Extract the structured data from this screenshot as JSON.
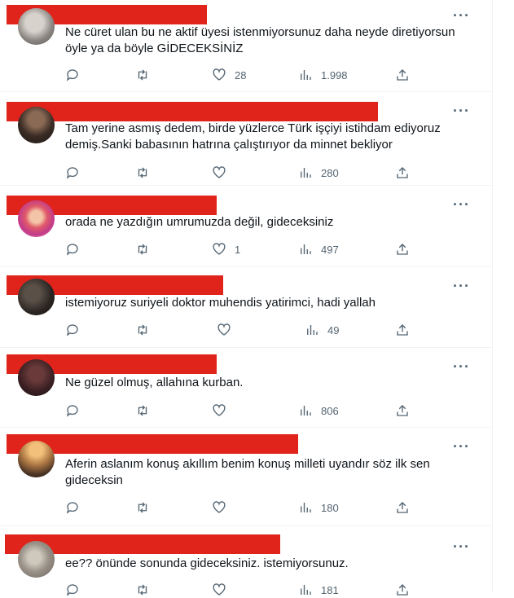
{
  "more_label": "···",
  "colors": {
    "redaction": "#e0241b",
    "icon": "#536471",
    "text": "#0f1419"
  },
  "tweets": [
    {
      "text": "Ne cüret ulan bu ne aktif üyesi istenmiyorsunuz daha neyde diretiyorsun öyle ya da böyle GİDECEKSİNİZ",
      "replies": "",
      "retweets": "",
      "likes": "28",
      "views": "1.998",
      "avatar": "gray-stone"
    },
    {
      "text": "Tam yerine asmış dedem, birde yüzlerce Türk işçiyi istihdam ediyoruz demiş.Sanki babasının hatrına çalıştırıyor da minnet bekliyor",
      "replies": "",
      "retweets": "",
      "likes": "",
      "views": "280",
      "avatar": "bearded-man"
    },
    {
      "text": "orada ne yazdığın umrumuzda değil, gideceksiniz",
      "replies": "",
      "retweets": "",
      "likes": "1",
      "views": "497",
      "avatar": "cartoon-girl"
    },
    {
      "text": "istemiyoruz suriyeli doktor muhendis yatirimci, hadi yallah",
      "replies": "",
      "retweets": "",
      "likes": "",
      "views": "49",
      "avatar": "dark-photo"
    },
    {
      "text": "Ne güzel olmuş, allahına kurban.",
      "replies": "",
      "retweets": "",
      "likes": "",
      "views": "806",
      "avatar": "dark-red"
    },
    {
      "text": "Aferin aslanım konuş akıllım benim konuş milleti uyandır söz ilk sen gideceksin",
      "replies": "",
      "retweets": "",
      "likes": "",
      "views": "180",
      "avatar": "sunset-man"
    },
    {
      "text": "ee?? önünde sonunda gideceksiniz. istemiyorsunuz.",
      "replies": "",
      "retweets": "",
      "likes": "",
      "views": "181",
      "avatar": "cat-photo"
    }
  ]
}
